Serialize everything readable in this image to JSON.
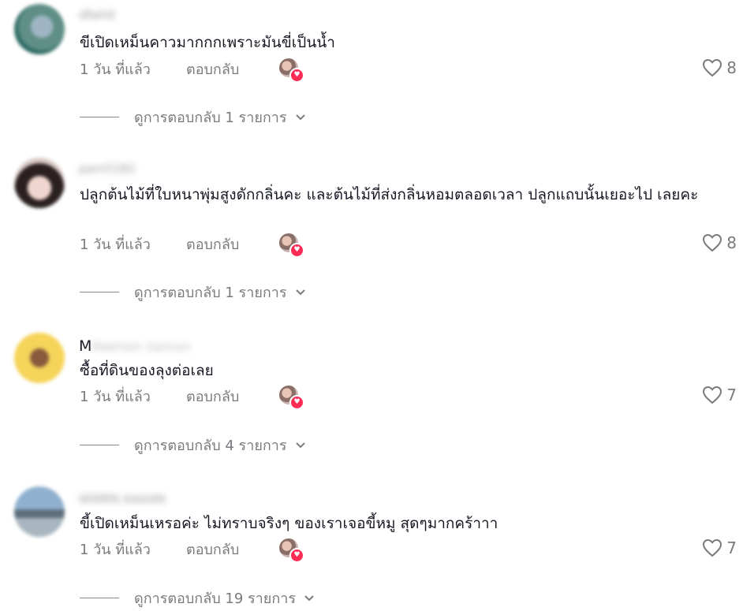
{
  "comments": [
    {
      "username_hidden": "dfwh6",
      "text": "ขีเปิดเหม็นคาวมากกกเพราะมันขี่เป็นน้ำ",
      "time": "1 วัน ที่แล้ว",
      "reply_label": "ตอบกลับ",
      "likes": "8",
      "view_replies": "ดูการตอบกลับ 1 รายการ",
      "avatar_color": "#6b8f8c"
    },
    {
      "username_hidden": "pam5182",
      "text": "ปลูกต้นไม้ที่ใบหนาพุ่มสูงดักกลิ่นคะ และต้นไม้ที่ส่งกลิ่นหอมตลอดเวลา ปลูกแถบนั้นเยอะไป เลยคะ",
      "time": "1 วัน ที่แล้ว",
      "reply_label": "ตอบกลับ",
      "likes": "8",
      "view_replies": "ดูการตอบกลับ 1 รายการ",
      "avatar_color": "#3a2d2e"
    },
    {
      "username_visible": "M",
      "username_hidden": "Makham Saimon",
      "text": "ซื้อที่ดินของลุงต่อเลย",
      "time": "1 วัน ที่แล้ว",
      "reply_label": "ตอบกลับ",
      "likes": "7",
      "view_replies": "ดูการตอบกลับ 4 รายการ",
      "avatar_color": "#f3d25c"
    },
    {
      "username_hidden": "WWRN AAAAN",
      "text": "ขี้เปิดเหม็นเหรอค่ะ ไม่ทราบจริงๆ ของเราเจอขี้หมู สุดๆมากคร้าาา",
      "time": "1 วัน ที่แล้ว",
      "reply_label": "ตอบกลับ",
      "likes": "7",
      "view_replies": "ดูการตอบกลับ 19 รายการ",
      "avatar_color": "#6f8ea8"
    }
  ],
  "colors": {
    "like_badge": "#fe2c55",
    "muted_text": "#7a7a7f"
  }
}
